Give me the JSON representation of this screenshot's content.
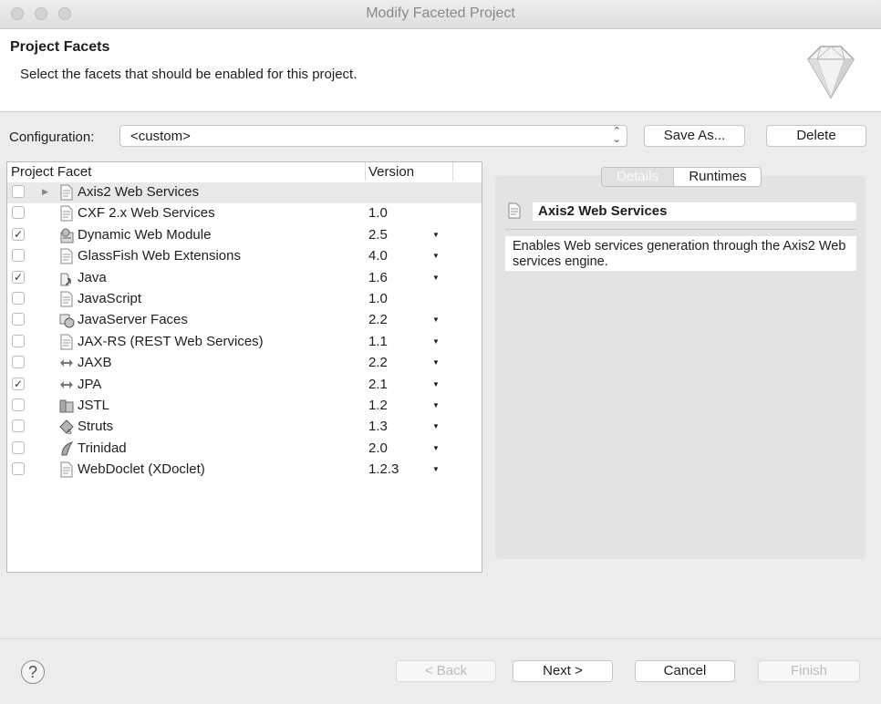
{
  "window": {
    "title": "Modify Faceted Project"
  },
  "header": {
    "title": "Project Facets",
    "subtitle": "Select the facets that should be enabled for this project."
  },
  "configuration": {
    "label": "Configuration:",
    "value": "<custom>",
    "save_as_label": "Save As...",
    "delete_label": "Delete"
  },
  "table": {
    "columns": [
      "Project Facet",
      "Version"
    ],
    "rows": [
      {
        "name": "Axis2 Web Services",
        "version": "",
        "checked": false,
        "dropdown": false,
        "icon": "page-icon",
        "expander": true,
        "selected": true
      },
      {
        "name": "CXF 2.x Web Services",
        "version": "1.0",
        "checked": false,
        "dropdown": false,
        "icon": "page-icon"
      },
      {
        "name": "Dynamic Web Module",
        "version": "2.5",
        "checked": true,
        "dropdown": true,
        "icon": "web-module-icon"
      },
      {
        "name": "GlassFish Web Extensions",
        "version": "4.0",
        "checked": false,
        "dropdown": true,
        "icon": "page-icon"
      },
      {
        "name": "Java",
        "version": "1.6",
        "checked": true,
        "dropdown": true,
        "icon": "java-icon"
      },
      {
        "name": "JavaScript",
        "version": "1.0",
        "checked": false,
        "dropdown": false,
        "icon": "page-icon"
      },
      {
        "name": "JavaServer Faces",
        "version": "2.2",
        "checked": false,
        "dropdown": true,
        "icon": "faces-icon"
      },
      {
        "name": "JAX-RS (REST Web Services)",
        "version": "1.1",
        "checked": false,
        "dropdown": true,
        "icon": "page-icon"
      },
      {
        "name": "JAXB",
        "version": "2.2",
        "checked": false,
        "dropdown": true,
        "icon": "bidirectional-arrow-icon"
      },
      {
        "name": "JPA",
        "version": "2.1",
        "checked": true,
        "dropdown": true,
        "icon": "bidirectional-arrow-icon"
      },
      {
        "name": "JSTL",
        "version": "1.2",
        "checked": false,
        "dropdown": true,
        "icon": "jstl-icon"
      },
      {
        "name": "Struts",
        "version": "1.3",
        "checked": false,
        "dropdown": true,
        "icon": "struts-icon"
      },
      {
        "name": "Trinidad",
        "version": "2.0",
        "checked": false,
        "dropdown": true,
        "icon": "trinidad-icon"
      },
      {
        "name": "WebDoclet (XDoclet)",
        "version": "1.2.3",
        "checked": false,
        "dropdown": true,
        "icon": "page-icon"
      }
    ]
  },
  "details": {
    "tabs": [
      "Details",
      "Runtimes"
    ],
    "active_tab": "Details",
    "title": "Axis2 Web Services",
    "description": "Enables Web services generation through the Axis2 Web services engine."
  },
  "footer": {
    "help": "?",
    "back_label": "< Back",
    "next_label": "Next >",
    "cancel_label": "Cancel",
    "finish_label": "Finish"
  }
}
